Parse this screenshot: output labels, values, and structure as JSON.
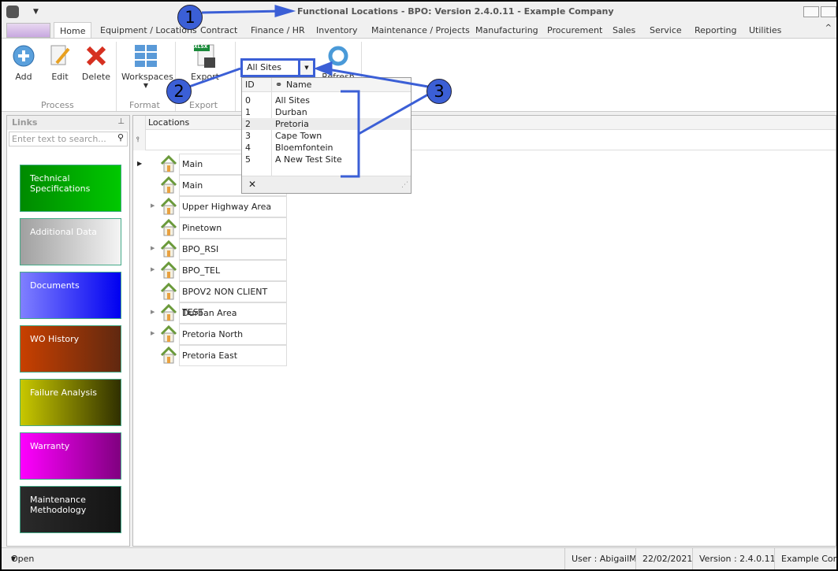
{
  "window": {
    "title": "Functional Locations - BPO: Version 2.4.0.11 - Example Company"
  },
  "tabs": [
    "Home",
    "Equipment / Locations",
    "Contract",
    "Finance / HR",
    "Inventory",
    "Maintenance / Projects",
    "Manufacturing",
    "Procurement",
    "Sales",
    "Service",
    "Reporting",
    "Utilities"
  ],
  "ribbon": {
    "add": "Add",
    "edit": "Edit",
    "delete": "Delete",
    "workspaces": "Workspaces",
    "export": "Export",
    "refresh": "Refresh",
    "xlsx": "XLSX",
    "groups": {
      "process": "Process",
      "format": "Format",
      "export": "Export"
    }
  },
  "site_combo": {
    "value": "All Sites",
    "columns": {
      "id": "ID",
      "name": "Name"
    },
    "options": [
      {
        "id": "0",
        "name": "All Sites"
      },
      {
        "id": "1",
        "name": "Durban"
      },
      {
        "id": "2",
        "name": "Pretoria"
      },
      {
        "id": "3",
        "name": "Cape Town"
      },
      {
        "id": "4",
        "name": "Bloemfontein"
      },
      {
        "id": "5",
        "name": "A New Test Site"
      }
    ],
    "highlighted": "2"
  },
  "links": {
    "title": "Links",
    "search_placeholder": "Enter text to search...",
    "tiles": [
      {
        "label": "Technical Specifications",
        "from": "#008a00",
        "to": "#00c800"
      },
      {
        "label": "Additional Data",
        "from": "#a0a0a0",
        "to": "#f4f4f4"
      },
      {
        "label": "Documents",
        "from": "#8080ff",
        "to": "#0000f0"
      },
      {
        "label": "WO History",
        "from": "#c84000",
        "to": "#602810"
      },
      {
        "label": "Failure Analysis",
        "from": "#c8c800",
        "to": "#303000"
      },
      {
        "label": "Warranty",
        "from": "#ff00ff",
        "to": "#800080"
      },
      {
        "label": "Maintenance Methodology",
        "from": "#2a2a2a",
        "to": "#141414"
      }
    ]
  },
  "grid": {
    "column": "Locations",
    "rows": [
      {
        "name": "Main",
        "expandable": false,
        "current": true
      },
      {
        "name": "Main",
        "expandable": false
      },
      {
        "name": "Upper Highway Area",
        "expandable": true
      },
      {
        "name": "Pinetown",
        "expandable": false
      },
      {
        "name": "BPO_RSI",
        "expandable": true
      },
      {
        "name": "BPO_TEL",
        "expandable": true
      },
      {
        "name": "BPOV2 NON CLIENT TEST",
        "expandable": false
      },
      {
        "name": "Durban Area",
        "expandable": true
      },
      {
        "name": "Pretoria North",
        "expandable": true
      },
      {
        "name": "Pretoria East",
        "expandable": false
      }
    ]
  },
  "status": {
    "open_windows": "Open Windows",
    "user": "User : AbigailM",
    "date": "22/02/2021",
    "version": "Version : 2.4.0.11",
    "company": "Example Comp"
  },
  "annotations": [
    "1",
    "2",
    "3"
  ],
  "colors": {
    "annotation": "#3b5fd6"
  }
}
